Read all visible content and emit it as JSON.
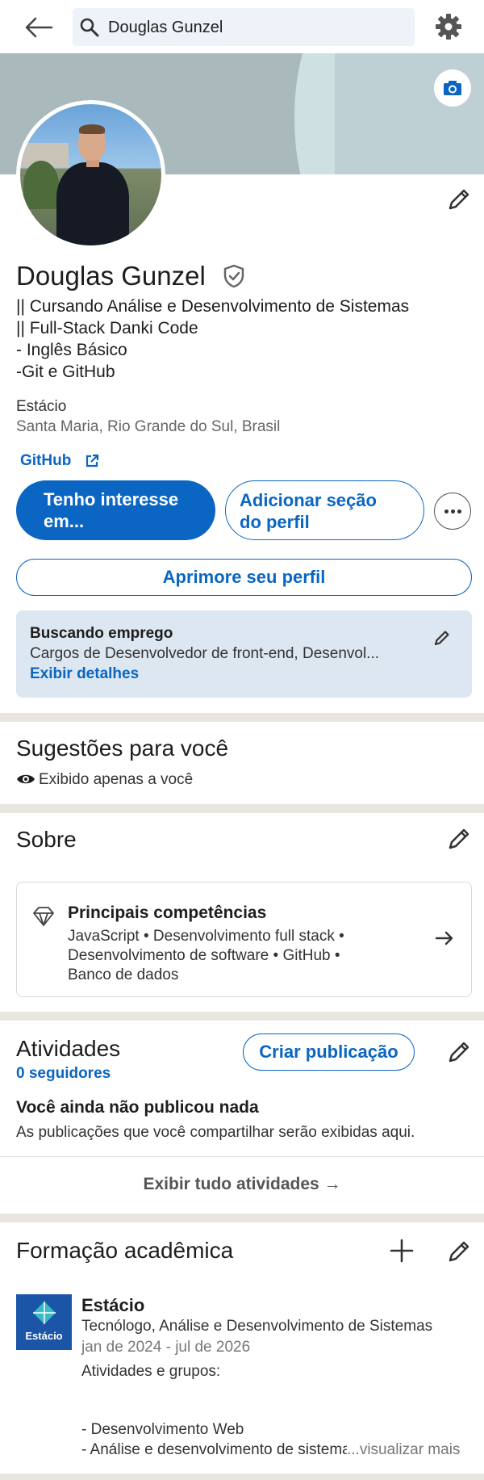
{
  "search": {
    "value": "Douglas Gunzel"
  },
  "profile": {
    "name": "Douglas Gunzel",
    "headline": [
      "|| Cursando Análise e Desenvolvimento de Sistemas",
      "|| Full-Stack Danki Code",
      "- Inglês Básico",
      "-Git e GitHub"
    ],
    "school": "Estácio",
    "location": "Santa Maria, Rio Grande do Sul, Brasil",
    "link_label": "GitHub"
  },
  "actions": {
    "interest_label": [
      "Tenho interesse",
      "em..."
    ],
    "add_section_label": [
      "Adicionar seção",
      "do perfil"
    ],
    "improve_label": "Aprimore seu perfil"
  },
  "open_to_work": {
    "title": "Buscando emprego",
    "roles": "Cargos de Desenvolvedor de front-end, Desenvol...",
    "details_link": "Exibir detalhes"
  },
  "suggestions": {
    "title": "Sugestões para você",
    "visibility": "Exibido apenas a você"
  },
  "about": {
    "title": "Sobre",
    "skills_title": "Principais competências",
    "skills_lines": [
      "JavaScript • Desenvolvimento full stack •",
      "Desenvolvimento de software • GitHub •",
      "Banco de dados"
    ]
  },
  "activity": {
    "title": "Atividades",
    "followers": "0 seguidores",
    "create_post": "Criar publicação",
    "empty_title": "Você ainda não publicou nada",
    "empty_sub": "As publicações que você compartilhar serão exibidas aqui.",
    "show_all": "Exibir tudo atividades →"
  },
  "education": {
    "title": "Formação acadêmica",
    "logo_text": "Estácio",
    "school": "Estácio",
    "degree": "Tecnólogo, Análise e Desenvolvimento de Sistemas",
    "dates": "jan de 2024 - jul de 2026",
    "activities_label": "Atividades e grupos:",
    "line1": "- Desenvolvimento Web",
    "line2": "- Análise e desenvolvimento de sistemas",
    "see_more": "...visualizar mais"
  },
  "colors": {
    "accent": "#0a66c2",
    "divider": "#e9e5df",
    "opento_bg": "#dde7f1"
  },
  "icons": [
    "back-arrow-icon",
    "search-icon",
    "gear-icon",
    "camera-icon",
    "pencil-icon",
    "shield-check-icon",
    "external-link-icon",
    "more-dots-icon",
    "eye-icon",
    "diamond-icon",
    "arrow-right-icon",
    "plus-icon"
  ]
}
